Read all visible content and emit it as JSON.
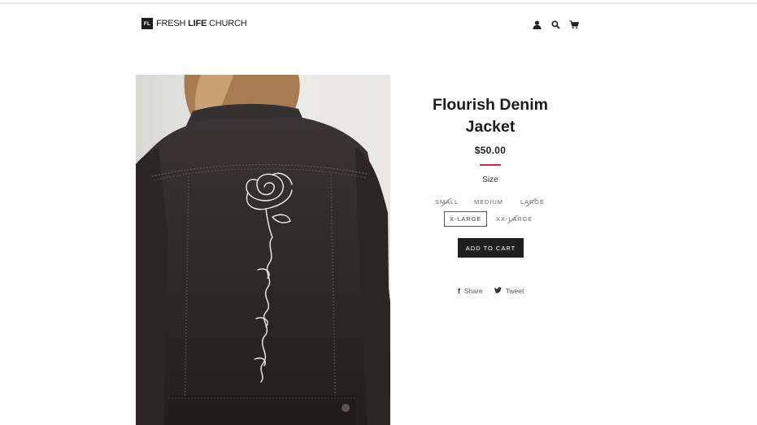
{
  "header": {
    "logo_mark": "FL",
    "logo_light_1": "Fresh ",
    "logo_bold": "Life",
    "logo_light_2": " Church",
    "icons": [
      "account-icon",
      "search-icon",
      "cart-icon"
    ]
  },
  "product": {
    "title": "Flourish Denim Jacket",
    "price": "$50.00",
    "accent_color": "#d62e2e",
    "size_label": "Size",
    "sizes": [
      {
        "label": "Small",
        "available": false
      },
      {
        "label": "Medium",
        "available": true
      },
      {
        "label": "Large",
        "available": false
      },
      {
        "label": "X-Large",
        "available": true,
        "selected": true
      },
      {
        "label": "XX-Large",
        "available": false
      }
    ],
    "add_to_cart": "Add to Cart"
  },
  "share": {
    "share_label": "Share",
    "tweet_label": "Tweet",
    "share_icon": "facebook-icon",
    "tweet_icon": "twitter-icon"
  }
}
